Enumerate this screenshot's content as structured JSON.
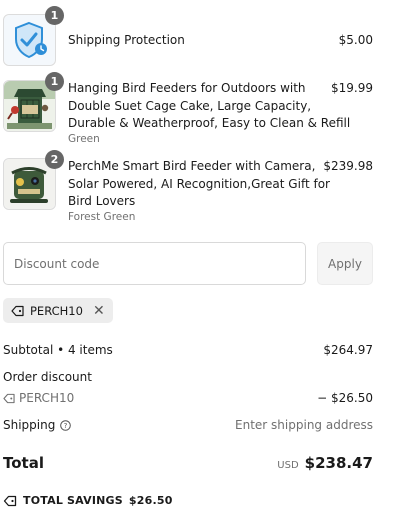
{
  "items": [
    {
      "name": "Shipping Protection",
      "variant": "",
      "price": "$5.00",
      "quantity": "1",
      "icon": "shield-check-icon"
    },
    {
      "name_lines": [
        "Hanging Bird Feeders for Outdoors with",
        "Double Suet Cage Cake, Large Capacity,",
        "Durable & Weatherproof, Easy to Clean & Refill"
      ],
      "variant": "Green",
      "price": "$19.99",
      "quantity": "1"
    },
    {
      "name_lines": [
        "PerchMe Smart Bird Feeder with Camera,",
        "Solar Powered, AI Recognition,Great Gift for",
        "Bird Lovers"
      ],
      "variant": "Forest Green",
      "price": "$239.98",
      "quantity": "2"
    }
  ],
  "discount": {
    "placeholder": "Discount code",
    "apply_label": "Apply",
    "applied_code": "PERCH10",
    "remove_glyph": "✕"
  },
  "summary": {
    "subtotal_label": "Subtotal • 4 items",
    "subtotal_value": "$264.97",
    "order_discount_label": "Order discount",
    "discount_code": "PERCH10",
    "discount_value": "− $26.50",
    "shipping_label": "Shipping",
    "shipping_value": "Enter shipping address",
    "total_label": "Total",
    "currency": "USD",
    "total_value": "$238.47",
    "savings_label": "TOTAL SAVINGS",
    "savings_value": "$26.50"
  },
  "colors": {
    "badge": "#666666",
    "shield_blue": "#2f8fd8",
    "muted_text": "#707070"
  }
}
